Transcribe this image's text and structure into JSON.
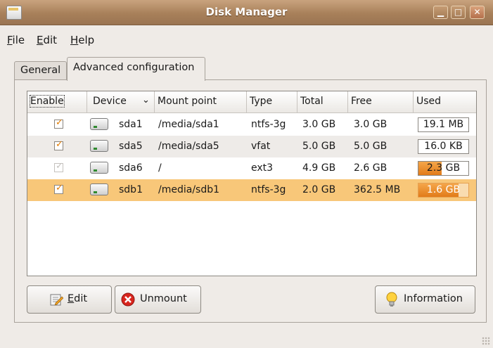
{
  "window": {
    "title": "Disk Manager"
  },
  "menu": [
    {
      "label": "File",
      "mnemonic": "F",
      "rest": "ile"
    },
    {
      "label": "Edit",
      "mnemonic": "E",
      "rest": "dit"
    },
    {
      "label": "Help",
      "mnemonic": "H",
      "rest": "elp"
    }
  ],
  "tabs": [
    {
      "label": "General",
      "active": false
    },
    {
      "label": "Advanced configuration",
      "active": true
    }
  ],
  "table": {
    "columns": [
      "Enable",
      "Device",
      "Mount point",
      "Type",
      "Total",
      "Free",
      "Used"
    ],
    "sort_indicator": "chevron-down",
    "rows": [
      {
        "enabled": true,
        "sensitive": true,
        "device": "sda1",
        "mount": "/media/sda1",
        "type": "ntfs-3g",
        "total": "3.0 GB",
        "free": "3.0 GB",
        "used": "19.1 MB",
        "used_fraction": 0.006
      },
      {
        "enabled": true,
        "sensitive": true,
        "device": "sda5",
        "mount": "/media/sda5",
        "type": "vfat",
        "total": "5.0 GB",
        "free": "5.0 GB",
        "used": "16.0 KB",
        "used_fraction": 0.0
      },
      {
        "enabled": true,
        "sensitive": false,
        "device": "sda6",
        "mount": "/",
        "type": "ext3",
        "total": "4.9 GB",
        "free": "2.6 GB",
        "used": "2.3 GB",
        "used_fraction": 0.47
      },
      {
        "enabled": true,
        "sensitive": true,
        "device": "sdb1",
        "mount": "/media/sdb1",
        "type": "ntfs-3g",
        "total": "2.0 GB",
        "free": "362.5 MB",
        "used": "1.6 GB",
        "used_fraction": 0.8,
        "selected": true
      }
    ]
  },
  "buttons": {
    "edit": {
      "mnemonic": "E",
      "rest": "dit"
    },
    "unmount": "Unmount",
    "information": "Information"
  },
  "colors": {
    "selection": "#f8c779",
    "progress": "#e27b19",
    "titlebar": "#a8805a"
  }
}
